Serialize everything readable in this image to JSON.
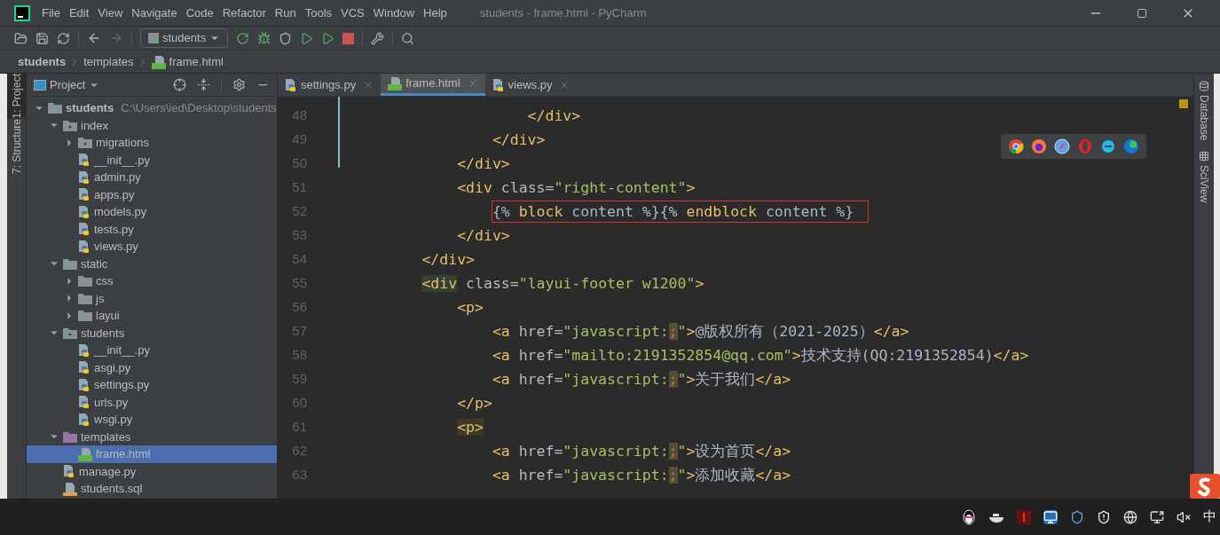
{
  "window": {
    "title": "students - frame.html - PyCharm"
  },
  "menu": [
    "File",
    "Edit",
    "View",
    "Navigate",
    "Code",
    "Refactor",
    "Run",
    "Tools",
    "VCS",
    "Window",
    "Help"
  ],
  "run_config": {
    "label": "students"
  },
  "breadcrumbs": [
    "students",
    "templates",
    "frame.html"
  ],
  "tool_tabs_left": [
    {
      "label": "1: Project",
      "selected": true
    },
    {
      "label": "7: Structure",
      "selected": false
    }
  ],
  "tool_tabs_right": [
    {
      "label": "Database"
    },
    {
      "label": "SciView"
    }
  ],
  "project": {
    "title": "Project",
    "tree": [
      {
        "name": "students",
        "path": "C:\\Users\\ied\\Desktop\\students",
        "kind": "folder",
        "expanded": true,
        "selected": false,
        "children": [
          {
            "name": "index",
            "kind": "package",
            "expanded": true,
            "selected": false,
            "children": [
              {
                "name": "migrations",
                "kind": "package",
                "expanded": false,
                "selected": false
              },
              {
                "name": "__init__.py",
                "kind": "python",
                "selected": false
              },
              {
                "name": "admin.py",
                "kind": "python",
                "selected": false
              },
              {
                "name": "apps.py",
                "kind": "python",
                "selected": false
              },
              {
                "name": "models.py",
                "kind": "python",
                "selected": false
              },
              {
                "name": "tests.py",
                "kind": "python",
                "selected": false
              },
              {
                "name": "views.py",
                "kind": "python",
                "selected": false
              }
            ]
          },
          {
            "name": "static",
            "kind": "folder",
            "expanded": true,
            "selected": false,
            "children": [
              {
                "name": "css",
                "kind": "folder",
                "expanded": false,
                "selected": false
              },
              {
                "name": "js",
                "kind": "folder",
                "expanded": false,
                "selected": false
              },
              {
                "name": "layui",
                "kind": "folder",
                "expanded": false,
                "selected": false
              }
            ]
          },
          {
            "name": "students",
            "kind": "package",
            "expanded": true,
            "selected": false,
            "children": [
              {
                "name": "__init__.py",
                "kind": "python",
                "selected": false
              },
              {
                "name": "asgi.py",
                "kind": "python",
                "selected": false
              },
              {
                "name": "settings.py",
                "kind": "python",
                "selected": false
              },
              {
                "name": "urls.py",
                "kind": "python",
                "selected": false
              },
              {
                "name": "wsgi.py",
                "kind": "python",
                "selected": false
              }
            ]
          },
          {
            "name": "templates",
            "kind": "templates",
            "expanded": true,
            "selected": false,
            "children": [
              {
                "name": "frame.html",
                "kind": "html",
                "selected": true
              }
            ]
          },
          {
            "name": "manage.py",
            "kind": "python",
            "selected": false
          },
          {
            "name": "students.sql",
            "kind": "sql",
            "selected": false
          }
        ]
      }
    ]
  },
  "editor_tabs": [
    {
      "label": "settings.py",
      "kind": "python",
      "selected": false
    },
    {
      "label": "frame.html",
      "kind": "html",
      "selected": true
    },
    {
      "label": "views.py",
      "kind": "python",
      "selected": false
    }
  ],
  "code": [
    {
      "number": "48",
      "tokens": [
        {
          "kind": "tag",
          "text": "                    </div>"
        }
      ]
    },
    {
      "number": "49",
      "tokens": [
        {
          "kind": "tag",
          "text": "                </div>"
        }
      ]
    },
    {
      "number": "50",
      "tokens": [
        {
          "kind": "tag",
          "text": "            </div>"
        }
      ]
    },
    {
      "number": "51",
      "tokens": [
        {
          "kind": "tag",
          "text": "            <div"
        },
        {
          "kind": "attr",
          "text": " class="
        },
        {
          "kind": "string",
          "text": "\"right-content\""
        },
        {
          "kind": "tag",
          "text": ">"
        }
      ]
    },
    {
      "number": "52",
      "boxed": true,
      "tokens": [
        {
          "kind": "brace",
          "text": "                {%"
        },
        {
          "kind": "keyword",
          "text": " block "
        },
        {
          "kind": "text",
          "text": "content "
        },
        {
          "kind": "brace",
          "text": "%}{%"
        },
        {
          "kind": "keyword",
          "text": " endblock "
        },
        {
          "kind": "text",
          "text": "content "
        },
        {
          "kind": "brace",
          "text": "%}"
        }
      ]
    },
    {
      "number": "53",
      "tokens": [
        {
          "kind": "tag",
          "text": "            </div>"
        }
      ]
    },
    {
      "number": "54",
      "tokens": [
        {
          "kind": "tag",
          "text": "        </div>"
        }
      ]
    },
    {
      "number": "55",
      "tokens": [
        {
          "kind": "tag-match",
          "text": "        <div"
        },
        {
          "kind": "attr",
          "text": " class="
        },
        {
          "kind": "string",
          "text": "\"layui-footer w1200\""
        },
        {
          "kind": "tag",
          "text": ">"
        }
      ]
    },
    {
      "number": "56",
      "tokens": [
        {
          "kind": "tag",
          "text": "            <p>"
        }
      ]
    },
    {
      "number": "57",
      "tokens": [
        {
          "kind": "tag",
          "text": "                <a"
        },
        {
          "kind": "attr",
          "text": " href="
        },
        {
          "kind": "string",
          "text": "\"javascript:"
        },
        {
          "kind": "semicolon",
          "text": ";"
        },
        {
          "kind": "string",
          "text": "\""
        },
        {
          "kind": "tag",
          "text": ">"
        },
        {
          "kind": "text",
          "text": "@版权所有（2021-2025）"
        },
        {
          "kind": "tag",
          "text": "</a>"
        }
      ]
    },
    {
      "number": "58",
      "tokens": [
        {
          "kind": "tag",
          "text": "                <a"
        },
        {
          "kind": "attr",
          "text": " href="
        },
        {
          "kind": "string",
          "text": "\"mailto:2191352854@qq.com\""
        },
        {
          "kind": "tag",
          "text": ">"
        },
        {
          "kind": "text",
          "text": "技术支持(QQ:2191352854)"
        },
        {
          "kind": "tag",
          "text": "</a>"
        }
      ]
    },
    {
      "number": "59",
      "tokens": [
        {
          "kind": "tag",
          "text": "                <a"
        },
        {
          "kind": "attr",
          "text": " href="
        },
        {
          "kind": "string",
          "text": "\"javascript:"
        },
        {
          "kind": "semicolon",
          "text": ";"
        },
        {
          "kind": "string",
          "text": "\""
        },
        {
          "kind": "tag",
          "text": ">"
        },
        {
          "kind": "text",
          "text": "关于我们"
        },
        {
          "kind": "tag",
          "text": "</a>"
        }
      ]
    },
    {
      "number": "60",
      "tokens": [
        {
          "kind": "tag",
          "text": "            </p>"
        }
      ]
    },
    {
      "number": "61",
      "tokens": [
        {
          "kind": "tag-hl",
          "text": "            <p>"
        }
      ]
    },
    {
      "number": "62",
      "tokens": [
        {
          "kind": "tag",
          "text": "                <a"
        },
        {
          "kind": "attr",
          "text": " href="
        },
        {
          "kind": "string",
          "text": "\"javascript:"
        },
        {
          "kind": "semicolon",
          "text": ";"
        },
        {
          "kind": "string",
          "text": "\""
        },
        {
          "kind": "tag",
          "text": ">"
        },
        {
          "kind": "text",
          "text": "设为首页"
        },
        {
          "kind": "tag",
          "text": "</a>"
        }
      ]
    },
    {
      "number": "63",
      "tokens": [
        {
          "kind": "tag",
          "text": "                <a"
        },
        {
          "kind": "attr",
          "text": " href="
        },
        {
          "kind": "string",
          "text": "\"javascript:"
        },
        {
          "kind": "semicolon",
          "text": ";"
        },
        {
          "kind": "string",
          "text": "\""
        },
        {
          "kind": "tag",
          "text": ">"
        },
        {
          "kind": "text",
          "text": "添加收藏"
        },
        {
          "kind": "tag",
          "text": "</a>"
        }
      ]
    }
  ],
  "taskbar": {
    "input_method": "中"
  }
}
